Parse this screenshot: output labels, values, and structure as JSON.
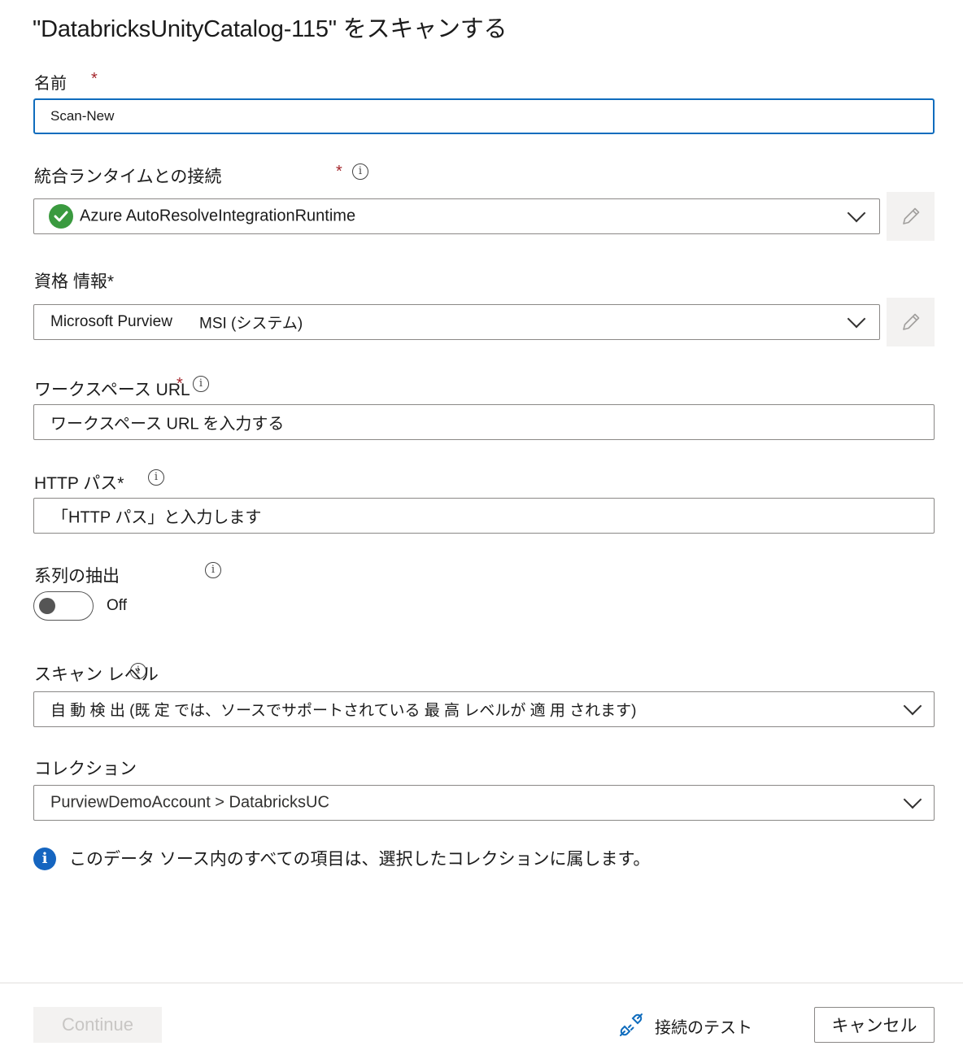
{
  "dialog": {
    "title": "\"DatabricksUnityCatalog-115\" をスキャンする"
  },
  "name": {
    "label": "名前",
    "required_mark": "*",
    "value": "Scan-New"
  },
  "runtime": {
    "label": "統合ランタイムとの接続",
    "required_mark": "*",
    "value": "Azure AutoResolveIntegrationRuntime",
    "status_color": "#3a9a3f"
  },
  "credential": {
    "label": "資格 情報*",
    "value_part1": "Microsoft Purview",
    "value_part2": "MSI (システム)"
  },
  "workspace_url": {
    "label": "ワークスペース URL",
    "required_mark": "*",
    "placeholder": "ワークスペース URL を入力する"
  },
  "http_path": {
    "label": "HTTP パス*",
    "placeholder": "「HTTP パス」と入力します"
  },
  "lineage": {
    "label": "系列の抽出",
    "toggle_state": "Off"
  },
  "scan_level": {
    "label": "スキャン レベル",
    "value": "自 動 検 出 (既 定 では、ソースでサポートされている 最 高 レベルが 適 用 されます)"
  },
  "collection": {
    "label": "コレクション",
    "value": "PurviewDemoAccount > DatabricksUC"
  },
  "info_message": "このデータ ソース内のすべての項目は、選択したコレクションに属します。",
  "footer": {
    "continue_label": "Continue",
    "test_connection_label": "接続のテスト",
    "cancel_label": "キャンセル"
  },
  "colors": {
    "accent": "#0f6cbd",
    "required": "#a4262c",
    "info": "#1565c0"
  }
}
